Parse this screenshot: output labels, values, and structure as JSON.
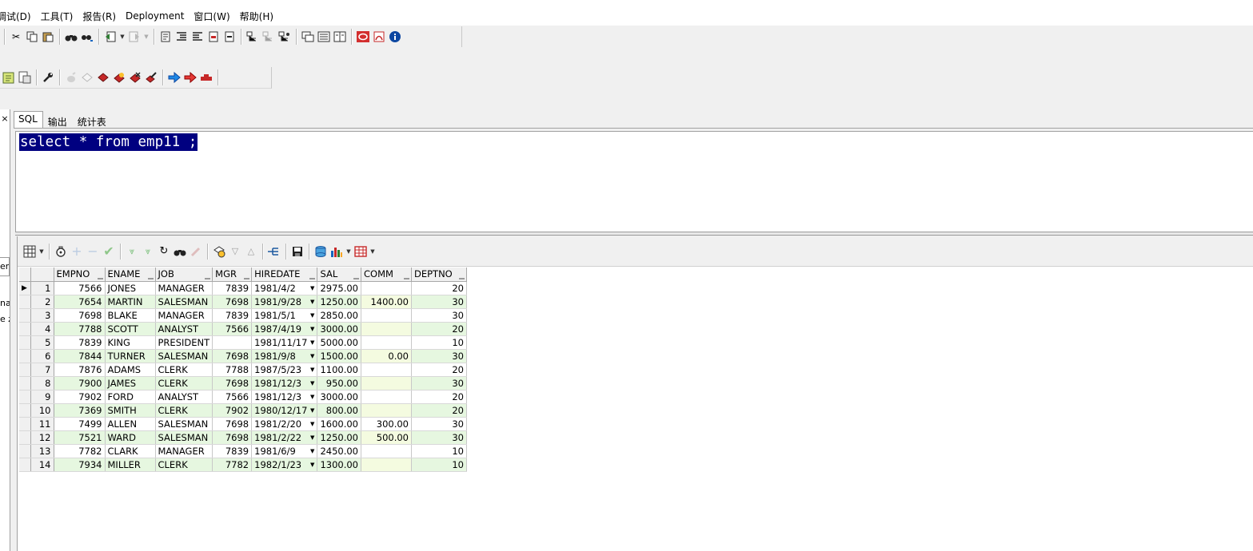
{
  "menu": [
    "调试(D)",
    "工具(T)",
    "报告(R)",
    "Deployment",
    "窗口(W)",
    "帮助(H)"
  ],
  "tabs": [
    "SQL",
    "输出",
    "统计表"
  ],
  "left_panel": {
    "close": "×",
    "box_text": "emp",
    "text1": "na",
    "text2": "e z"
  },
  "editor": {
    "sql": "select * from emp11 ;"
  },
  "grid": {
    "columns": [
      "EMPNO",
      "ENAME",
      "JOB",
      "MGR",
      "HIREDATE",
      "SAL",
      "COMM",
      "DEPTNO"
    ],
    "rows": [
      {
        "n": "1",
        "empno": "7566",
        "ename": "JONES",
        "job": "MANAGER",
        "mgr": "7839",
        "hiredate": "1981/4/2",
        "sal": "2975.00",
        "comm": "",
        "deptno": "20"
      },
      {
        "n": "2",
        "empno": "7654",
        "ename": "MARTIN",
        "job": "SALESMAN",
        "mgr": "7698",
        "hiredate": "1981/9/28",
        "sal": "1250.00",
        "comm": "1400.00",
        "deptno": "30"
      },
      {
        "n": "3",
        "empno": "7698",
        "ename": "BLAKE",
        "job": "MANAGER",
        "mgr": "7839",
        "hiredate": "1981/5/1",
        "sal": "2850.00",
        "comm": "",
        "deptno": "30"
      },
      {
        "n": "4",
        "empno": "7788",
        "ename": "SCOTT",
        "job": "ANALYST",
        "mgr": "7566",
        "hiredate": "1987/4/19",
        "sal": "3000.00",
        "comm": "",
        "deptno": "20"
      },
      {
        "n": "5",
        "empno": "7839",
        "ename": "KING",
        "job": "PRESIDENT",
        "mgr": "",
        "hiredate": "1981/11/17",
        "sal": "5000.00",
        "comm": "",
        "deptno": "10"
      },
      {
        "n": "6",
        "empno": "7844",
        "ename": "TURNER",
        "job": "SALESMAN",
        "mgr": "7698",
        "hiredate": "1981/9/8",
        "sal": "1500.00",
        "comm": "0.00",
        "deptno": "30"
      },
      {
        "n": "7",
        "empno": "7876",
        "ename": "ADAMS",
        "job": "CLERK",
        "mgr": "7788",
        "hiredate": "1987/5/23",
        "sal": "1100.00",
        "comm": "",
        "deptno": "20"
      },
      {
        "n": "8",
        "empno": "7900",
        "ename": "JAMES",
        "job": "CLERK",
        "mgr": "7698",
        "hiredate": "1981/12/3",
        "sal": "950.00",
        "comm": "",
        "deptno": "30"
      },
      {
        "n": "9",
        "empno": "7902",
        "ename": "FORD",
        "job": "ANALYST",
        "mgr": "7566",
        "hiredate": "1981/12/3",
        "sal": "3000.00",
        "comm": "",
        "deptno": "20"
      },
      {
        "n": "10",
        "empno": "7369",
        "ename": "SMITH",
        "job": "CLERK",
        "mgr": "7902",
        "hiredate": "1980/12/17",
        "sal": "800.00",
        "comm": "",
        "deptno": "20"
      },
      {
        "n": "11",
        "empno": "7499",
        "ename": "ALLEN",
        "job": "SALESMAN",
        "mgr": "7698",
        "hiredate": "1981/2/20",
        "sal": "1600.00",
        "comm": "300.00",
        "deptno": "30"
      },
      {
        "n": "12",
        "empno": "7521",
        "ename": "WARD",
        "job": "SALESMAN",
        "mgr": "7698",
        "hiredate": "1981/2/22",
        "sal": "1250.00",
        "comm": "500.00",
        "deptno": "30"
      },
      {
        "n": "13",
        "empno": "7782",
        "ename": "CLARK",
        "job": "MANAGER",
        "mgr": "7839",
        "hiredate": "1981/6/9",
        "sal": "2450.00",
        "comm": "",
        "deptno": "10"
      },
      {
        "n": "14",
        "empno": "7934",
        "ename": "MILLER",
        "job": "CLERK",
        "mgr": "7782",
        "hiredate": "1982/1/23",
        "sal": "1300.00",
        "comm": "",
        "deptno": "10"
      }
    ]
  },
  "icons": {
    "toolbar1": [
      "cut-icon",
      "copy-icon",
      "paste-icon",
      "find-icon",
      "replace-icon",
      "back-icon",
      "forward-icon",
      "comment-icon",
      "indent-icon",
      "outdent-icon",
      "uppercase-icon",
      "lowercase-icon",
      "explain-plan-icon",
      "autotrace-icon",
      "debug-icon",
      "window-list-icon",
      "session-icon",
      "sql-window-icon",
      "oracle-icon",
      "pdf-icon",
      "info-icon"
    ],
    "toolbar2": [
      "new-file-icon",
      "report-icon",
      "wrench-icon",
      "db-connect-icon",
      "db-disconnect-icon",
      "db-red-icon",
      "db-yellow-icon",
      "db-remove-icon",
      "db-edit-icon",
      "arrow-right-blue-icon",
      "arrow-right-red-icon",
      "key-red-icon"
    ],
    "grid_toolbar": [
      "grid-layout-icon",
      "lock-icon",
      "add-record-icon",
      "delete-record-icon",
      "post-icon",
      "fetch-next-icon",
      "fetch-all-icon",
      "refresh-icon",
      "find-icon",
      "clear-icon",
      "query-by-example-icon",
      "previous-query-icon",
      "next-query-icon",
      "link-icon",
      "save-icon",
      "export-icon",
      "chart-icon",
      "table-icon"
    ]
  }
}
